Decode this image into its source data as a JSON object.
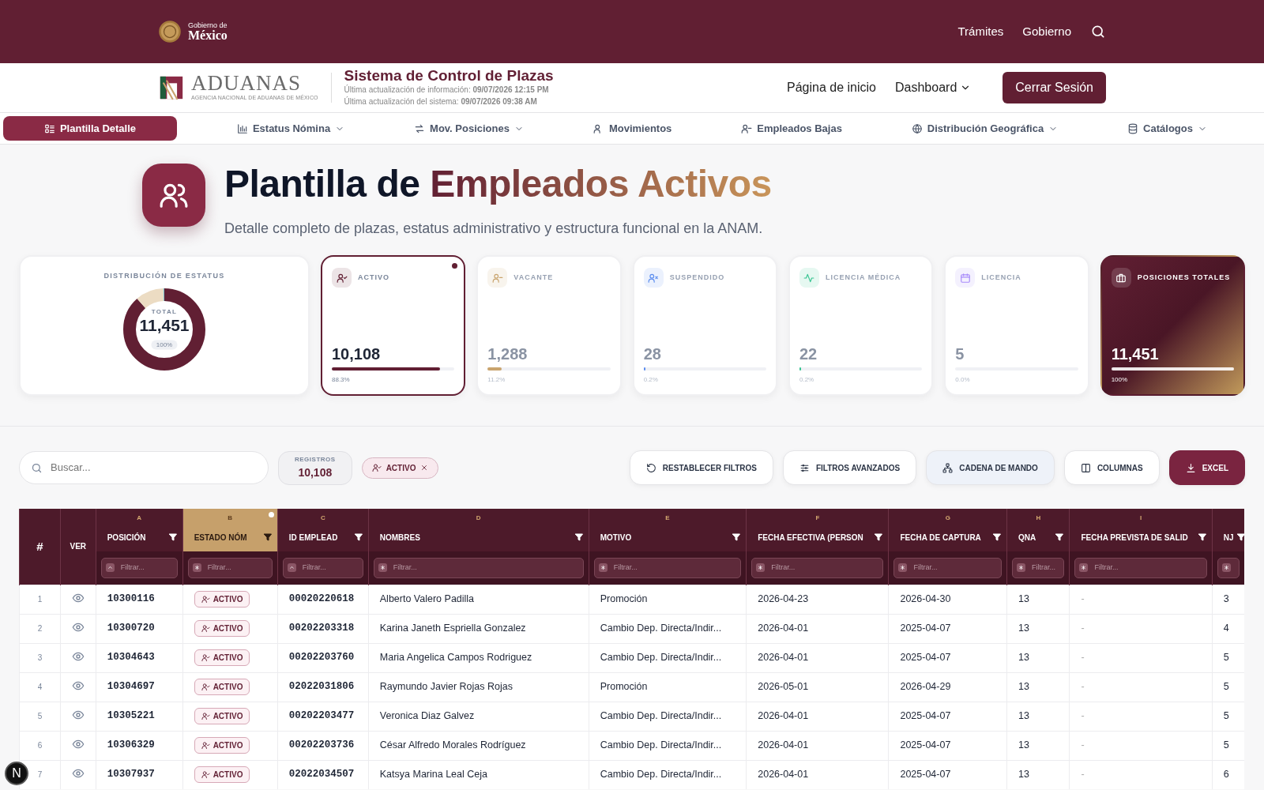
{
  "top_bar": {
    "logo_small": "Gobierno de",
    "logo_large": "México",
    "links": [
      "Trámites",
      "Gobierno"
    ]
  },
  "header": {
    "brand": "ADUANAS",
    "brand_sub": "AGENCIA NACIONAL DE ADUANAS DE MÉXICO",
    "system_title": "Sistema de Control de Plazas",
    "updates": [
      "Última actualización de información: **09/07/2026 12:15 PM**",
      "Última actualización del sistema: **09/07/2026 09:38 AM**"
    ],
    "links": [
      {
        "label": "Página de inicio",
        "dropdown": false
      },
      {
        "label": "Dashboard",
        "dropdown": true
      }
    ],
    "logout": "Cerrar Sesión"
  },
  "nav": [
    {
      "label": "Plantilla Detalle",
      "selected": true,
      "dropdown": false
    },
    {
      "label": "Estatus Nómina",
      "selected": false,
      "dropdown": true
    },
    {
      "label": "Mov. Posiciones",
      "selected": false,
      "dropdown": true
    },
    {
      "label": "Movimientos",
      "selected": false,
      "dropdown": false
    },
    {
      "label": "Empleados Bajas",
      "selected": false,
      "dropdown": false
    },
    {
      "label": "Distribución Geográfica",
      "selected": false,
      "dropdown": true
    },
    {
      "label": "Catálogos",
      "selected": false,
      "dropdown": true
    }
  ],
  "hero": {
    "title": "Plantilla de **Empleados Activos**",
    "subtitle": "Detalle completo de plazas, estatus administrativo y estructura funcional en la ANAM."
  },
  "distribution": {
    "title": "DISTRIBUCIÓN DE ESTATUS",
    "total_label": "TOTAL",
    "total": "11,451",
    "percent": "100%"
  },
  "status_cards": [
    {
      "kind": "status",
      "label": "ACTIVO",
      "value": "10,108",
      "percent": "88.3%",
      "level": 0.883,
      "color": "#611f33",
      "selected": true
    },
    {
      "kind": "status",
      "label": "VACANTE",
      "value": "1,288",
      "percent": "11.2%",
      "level": 0.112,
      "color": "#c9a46e",
      "selected": false
    },
    {
      "kind": "status",
      "label": "SUSPENDIDO",
      "value": "28",
      "percent": "0.2%",
      "level": 0.002,
      "color": "#5b8def",
      "selected": false
    },
    {
      "kind": "status",
      "label": "LICENCIA MÉDICA",
      "value": "22",
      "percent": "0.2%",
      "level": 0.002,
      "color": "#34c38f",
      "selected": false
    },
    {
      "kind": "status",
      "label": "LICENCIA",
      "value": "5",
      "percent": "0.0%",
      "level": 0.0,
      "color": "#a78bfa",
      "selected": false
    },
    {
      "kind": "total",
      "label": "POSICIONES TOTALES",
      "value": "11,451",
      "percent": "100%",
      "level": 1.0,
      "selected": false
    }
  ],
  "toolbar": {
    "search_placeholder": "Buscar...",
    "records_label": "REGISTROS",
    "records": "10,108",
    "filter_chip": "ACTIVO",
    "buttons": [
      {
        "label": "RESTABLECER FILTROS",
        "kind": "default"
      },
      {
        "label": "FILTROS AVANZADOS",
        "kind": "default"
      },
      {
        "label": "CADENA DE MANDO",
        "kind": "tinted"
      },
      {
        "label": "COLUMNAS",
        "kind": "default"
      },
      {
        "label": "EXCEL",
        "kind": "primary"
      }
    ]
  },
  "table": {
    "columns": [
      {
        "label": "#"
      },
      {
        "label": "VER"
      },
      {
        "letter": "A",
        "label": "POSICIÓN",
        "selected": false,
        "filter": {
          "placeholder": "Filtrar...",
          "sorted": true
        }
      },
      {
        "letter": "B",
        "label": "ESTADO NÓM",
        "selected": true,
        "filter": {
          "placeholder": "Filtrar...",
          "sorted": false
        }
      },
      {
        "letter": "C",
        "label": "ID EMPLEAD",
        "selected": false,
        "filter": {
          "placeholder": "Filtrar...",
          "sorted": true
        }
      },
      {
        "letter": "D",
        "label": "NOMBRES",
        "selected": false,
        "filter": {
          "placeholder": "Filtrar...",
          "sorted": false
        }
      },
      {
        "letter": "E",
        "label": "MOTIVO",
        "selected": false,
        "filter": {
          "placeholder": "Filtrar...",
          "sorted": false
        }
      },
      {
        "letter": "F",
        "label": "FECHA EFECTIVA (PERSON",
        "selected": false,
        "filter": {
          "placeholder": "Filtrar...",
          "sorted": false
        }
      },
      {
        "letter": "G",
        "label": "FECHA DE CAPTURA",
        "selected": false,
        "filter": {
          "placeholder": "Filtrar...",
          "sorted": false
        }
      },
      {
        "letter": "H",
        "label": "QNA",
        "selected": false,
        "filter": {
          "placeholder": "Filtrar...",
          "sorted": false
        }
      },
      {
        "letter": "I",
        "label": "FECHA PREVISTA DE SALID",
        "selected": false,
        "filter": {
          "placeholder": "Filtrar...",
          "sorted": false
        }
      },
      {
        "label": "NJ",
        "selected": false,
        "filter": {
          "sorted": false
        }
      }
    ],
    "rows": [
      [
        "1",
        "",
        "10300116",
        "ACTIVO",
        "00020220618",
        "Alberto Valero Padilla",
        "Promoción",
        "2026-04-23",
        "2026-04-30",
        "13",
        "-",
        "3"
      ],
      [
        "2",
        "",
        "10300720",
        "ACTIVO",
        "00202203318",
        "Karina Janeth Espriella Gonzalez",
        "Cambio Dep. Directa/Indir...",
        "2026-04-01",
        "2025-04-07",
        "13",
        "-",
        "4"
      ],
      [
        "3",
        "",
        "10304643",
        "ACTIVO",
        "00202203760",
        "Maria Angelica Campos Rodriguez",
        "Cambio Dep. Directa/Indir...",
        "2026-04-01",
        "2025-04-07",
        "13",
        "-",
        "5"
      ],
      [
        "4",
        "",
        "10304697",
        "ACTIVO",
        "02022031806",
        "Raymundo Javier Rojas Rojas",
        "Promoción",
        "2026-05-01",
        "2026-04-29",
        "13",
        "-",
        "5"
      ],
      [
        "5",
        "",
        "10305221",
        "ACTIVO",
        "00202203477",
        "Veronica Diaz Galvez",
        "Cambio Dep. Directa/Indir...",
        "2026-04-01",
        "2025-04-07",
        "13",
        "-",
        "5"
      ],
      [
        "6",
        "",
        "10306329",
        "ACTIVO",
        "00202203736",
        "César Alfredo Morales Rodríguez",
        "Cambio Dep. Directa/Indir...",
        "2026-04-01",
        "2025-04-07",
        "13",
        "-",
        "5"
      ],
      [
        "7",
        "",
        "10307937",
        "ACTIVO",
        "02022034507",
        "Katsya Marina Leal Ceja",
        "Cambio Dep. Directa/Indir...",
        "2026-04-01",
        "2025-04-07",
        "13",
        "-",
        "6"
      ]
    ]
  },
  "dev_badge": "N"
}
